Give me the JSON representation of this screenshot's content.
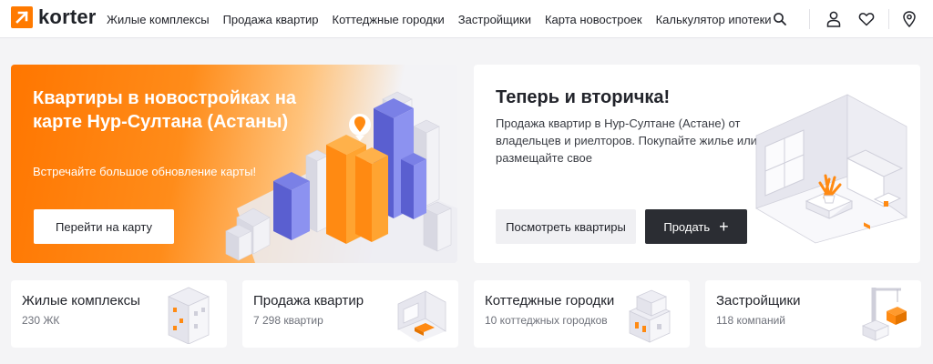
{
  "brand": {
    "name": "korter",
    "accent": "#ff7a00"
  },
  "nav": [
    "Жилые комплексы",
    "Продажа квартир",
    "Коттеджные городки",
    "Застройщики",
    "Карта новостроек",
    "Калькулятор ипотеки"
  ],
  "header_icons": [
    "search-icon",
    "user-icon",
    "heart-icon",
    "location-pin-icon"
  ],
  "hero_map": {
    "title": "Квартиры в новостройках на карте Нур-Султана (Астаны)",
    "subtitle": "Встречайте большое обновление карты!",
    "button": "Перейти на карту"
  },
  "hero_secondary": {
    "title": "Теперь и вторичка!",
    "description": "Продажа квартир в Нур-Султане (Астане) от владельцев и риелторов. Покупайте жилье или размещайте свое",
    "button_view": "Посмотреть квартиры",
    "button_sell": "Продать",
    "button_sell_icon": "plus-icon"
  },
  "categories": [
    {
      "title": "Жилые комплексы",
      "subtitle": "230 ЖК"
    },
    {
      "title": "Продажа квартир",
      "subtitle": "7 298 квартир"
    },
    {
      "title": "Коттеджные городки",
      "subtitle": "10 коттеджных городков"
    },
    {
      "title": "Застройщики",
      "subtitle": "118 компаний"
    }
  ]
}
